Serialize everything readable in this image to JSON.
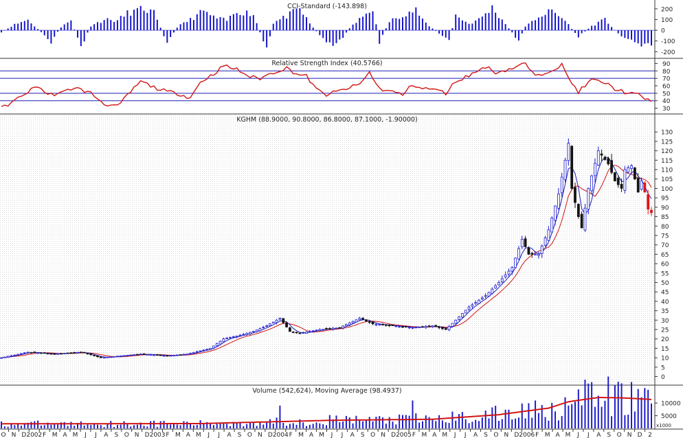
{
  "chart_data": [
    {
      "type": "bar",
      "title": "CCI-Standard (-143.898)",
      "yticks": [
        200,
        100,
        0,
        -100,
        -200
      ],
      "ylim": [
        -230,
        250
      ],
      "colors": {
        "bars": "#1414c8"
      },
      "keypoints": [
        [
          0,
          -25
        ],
        [
          3,
          40
        ],
        [
          8,
          100
        ],
        [
          12,
          -20
        ],
        [
          15,
          -110
        ],
        [
          18,
          30
        ],
        [
          21,
          90
        ],
        [
          24,
          -160
        ],
        [
          27,
          40
        ],
        [
          31,
          100
        ],
        [
          35,
          90
        ],
        [
          38,
          160
        ],
        [
          43,
          200
        ],
        [
          46,
          160
        ],
        [
          50,
          -120
        ],
        [
          53,
          30
        ],
        [
          57,
          100
        ],
        [
          61,
          180
        ],
        [
          64,
          120
        ],
        [
          68,
          90
        ],
        [
          71,
          180
        ],
        [
          76,
          150
        ],
        [
          80,
          -190
        ],
        [
          82,
          70
        ],
        [
          86,
          130
        ],
        [
          90,
          200
        ],
        [
          93,
          60
        ],
        [
          97,
          -80
        ],
        [
          101,
          -140
        ],
        [
          105,
          20
        ],
        [
          108,
          100
        ],
        [
          112,
          210
        ],
        [
          114,
          -110
        ],
        [
          117,
          80
        ],
        [
          121,
          150
        ],
        [
          125,
          190
        ],
        [
          128,
          60
        ],
        [
          132,
          -30
        ],
        [
          135,
          -100
        ],
        [
          137,
          140
        ],
        [
          141,
          60
        ],
        [
          144,
          100
        ],
        [
          148,
          210
        ],
        [
          152,
          60
        ],
        [
          156,
          -100
        ],
        [
          158,
          30
        ],
        [
          162,
          130
        ],
        [
          166,
          180
        ],
        [
          170,
          90
        ],
        [
          174,
          -60
        ],
        [
          178,
          40
        ],
        [
          182,
          100
        ],
        [
          186,
          -30
        ],
        [
          190,
          -100
        ],
        [
          195,
          -144
        ]
      ]
    },
    {
      "type": "line",
      "title": "Relative Strength Index (40.5766)",
      "yticks": [
        90,
        80,
        70,
        60,
        50,
        40,
        30
      ],
      "ylim": [
        25,
        95
      ],
      "reference_lines": [
        80,
        70,
        50,
        40
      ],
      "colors": {
        "line": "#d01414",
        "reference": "#1c1cb4"
      },
      "keypoints": [
        [
          0,
          30
        ],
        [
          4,
          40
        ],
        [
          8,
          52
        ],
        [
          11,
          60
        ],
        [
          14,
          48
        ],
        [
          18,
          50
        ],
        [
          22,
          58
        ],
        [
          27,
          50
        ],
        [
          31,
          36
        ],
        [
          35,
          32
        ],
        [
          39,
          52
        ],
        [
          42,
          66
        ],
        [
          46,
          58
        ],
        [
          50,
          52
        ],
        [
          53,
          50
        ],
        [
          57,
          44
        ],
        [
          60,
          65
        ],
        [
          64,
          76
        ],
        [
          67,
          87
        ],
        [
          71,
          82
        ],
        [
          75,
          72
        ],
        [
          78,
          70
        ],
        [
          82,
          78
        ],
        [
          86,
          84
        ],
        [
          89,
          76
        ],
        [
          92,
          73
        ],
        [
          95,
          55
        ],
        [
          98,
          48
        ],
        [
          101,
          52
        ],
        [
          104,
          56
        ],
        [
          108,
          62
        ],
        [
          111,
          78
        ],
        [
          114,
          56
        ],
        [
          118,
          52
        ],
        [
          121,
          48
        ],
        [
          124,
          62
        ],
        [
          127,
          56
        ],
        [
          130,
          56
        ],
        [
          134,
          50
        ],
        [
          137,
          66
        ],
        [
          142,
          76
        ],
        [
          146,
          86
        ],
        [
          149,
          78
        ],
        [
          153,
          82
        ],
        [
          158,
          90
        ],
        [
          161,
          72
        ],
        [
          165,
          80
        ],
        [
          169,
          88
        ],
        [
          171,
          70
        ],
        [
          174,
          52
        ],
        [
          178,
          68
        ],
        [
          182,
          64
        ],
        [
          185,
          56
        ],
        [
          189,
          50
        ],
        [
          192,
          48
        ],
        [
          195,
          41
        ]
      ]
    },
    {
      "type": "candlestick",
      "title": "KGHM (88.9000, 90.8000, 86.8000, 87.1000, -1.90000)",
      "yticks": [
        130,
        125,
        120,
        115,
        110,
        105,
        100,
        95,
        90,
        85,
        80,
        75,
        70,
        65,
        60,
        55,
        50,
        45,
        40,
        35,
        30,
        25,
        20,
        15,
        10,
        5,
        0
      ],
      "ylim": [
        -2,
        133
      ],
      "last_bar": {
        "open": 88.9,
        "high": 90.8,
        "low": 86.8,
        "close": 87.1,
        "change": -1.9
      },
      "colors": {
        "up": "#1c1cd0",
        "down": "#141414",
        "last_down": "#e01414",
        "ma_short": "#1c1cb4",
        "ma_long": "#d01414"
      },
      "price_keypoints": [
        [
          0,
          10
        ],
        [
          8,
          13
        ],
        [
          16,
          12
        ],
        [
          24,
          13
        ],
        [
          30,
          10
        ],
        [
          36,
          11
        ],
        [
          42,
          12
        ],
        [
          50,
          11
        ],
        [
          56,
          12
        ],
        [
          63,
          15
        ],
        [
          67,
          20
        ],
        [
          72,
          22
        ],
        [
          76,
          24
        ],
        [
          80,
          27
        ],
        [
          84,
          31
        ],
        [
          87,
          24
        ],
        [
          90,
          23
        ],
        [
          96,
          25
        ],
        [
          102,
          26
        ],
        [
          108,
          31
        ],
        [
          112,
          28
        ],
        [
          118,
          27
        ],
        [
          124,
          26
        ],
        [
          130,
          27
        ],
        [
          134,
          25
        ],
        [
          137,
          30
        ],
        [
          141,
          37
        ],
        [
          146,
          43
        ],
        [
          150,
          50
        ],
        [
          154,
          58
        ],
        [
          157,
          73
        ],
        [
          159,
          65
        ],
        [
          162,
          65
        ],
        [
          165,
          78
        ],
        [
          168,
          97
        ],
        [
          171,
          124
        ],
        [
          172,
          100
        ],
        [
          174,
          85
        ],
        [
          175,
          79
        ],
        [
          177,
          100
        ],
        [
          180,
          120
        ],
        [
          183,
          113
        ],
        [
          185,
          104
        ],
        [
          187,
          100
        ],
        [
          188,
          110
        ],
        [
          190,
          112
        ],
        [
          192,
          98
        ],
        [
          193,
          104
        ],
        [
          194,
          98
        ],
        [
          195,
          89
        ],
        [
          196,
          87.1
        ]
      ],
      "moving_averages": [
        "short",
        "long"
      ]
    },
    {
      "type": "bar",
      "title": "Volume (542,624), Moving Average (98.4937)",
      "yticks": [
        10000,
        5000
      ],
      "ylim": [
        0,
        13000
      ],
      "unit_label": "x1000",
      "colors": {
        "bars": "#1c1cc8",
        "ma": "#d01414"
      },
      "ma_keypoints": [
        [
          0,
          1800
        ],
        [
          60,
          1900
        ],
        [
          100,
          3200
        ],
        [
          130,
          3600
        ],
        [
          150,
          5400
        ],
        [
          165,
          8000
        ],
        [
          171,
          10500
        ],
        [
          180,
          12200
        ],
        [
          188,
          12000
        ],
        [
          196,
          11400
        ]
      ],
      "spikes": [
        [
          84,
          9000
        ],
        [
          124,
          11000
        ],
        [
          161,
          11000
        ],
        [
          171,
          9000
        ],
        [
          173,
          10500
        ]
      ]
    }
  ],
  "x_axis": {
    "labels": [
      "O",
      "N",
      "D",
      "2002",
      "F",
      "M",
      "A",
      "M",
      "J",
      "J",
      "A",
      "S",
      "O",
      "N",
      "D",
      "2003",
      "F",
      "M",
      "A",
      "M",
      "J",
      "J",
      "A",
      "S",
      "O",
      "N",
      "D",
      "2004",
      "F",
      "M",
      "A",
      "M",
      "J",
      "J",
      "A",
      "S",
      "O",
      "N",
      "D",
      "2005",
      "F",
      "M",
      "A",
      "M",
      "J",
      "J",
      "A",
      "S",
      "O",
      "N",
      "D",
      "2006",
      "F",
      "M",
      "A",
      "M",
      "J",
      "J",
      "A",
      "S",
      "O",
      "N",
      "D",
      "2"
    ]
  }
}
